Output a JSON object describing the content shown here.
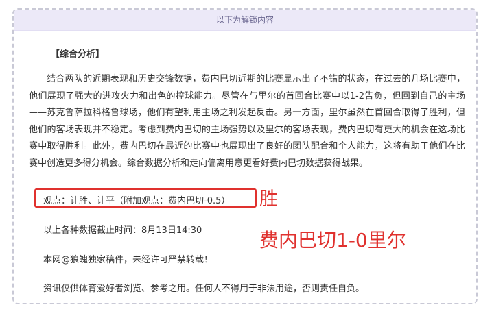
{
  "header": {
    "label": "以下为解锁内容"
  },
  "article": {
    "section_title": "【综合分析】",
    "analysis_paragraph": "结合两队的近期表现和历史交锋数据，费内巴切近期的比赛显示出了不错的状态，在过去的几场比赛中，他们展现了强大的进攻火力和出色的控球能力。尽管在与里尔的首回合比赛中以1-2告负，但回到自己的主场——苏克鲁萨拉科格鲁球场，他们有望利用主场之利发起反击。另一方面，里尔虽然在首回合取得了胜利，但他们的客场表现并不稳定。考虑到费内巴切的主场强势以及里尔的客场表现，费内巴切有更大的机会在这场比赛中取得胜利。此外，费内巴切在最近的比赛中也展现出了良好的团队配合和个人能力，这将有助于他们在比赛中创造更多得分机会。综合数据分析和走向偏离用意更看好费内巴切数据获得战果。",
    "viewpoint": "观点：让胜、让平（附加观点：费内巴切-0.5）",
    "deadline": "以上各种数据截止时间：8月13日14:30",
    "copyright": "本网@狼魄独家稿件，未经许可严禁转载！",
    "disclaimer": "资讯仅供体育爱好者浏览、参考之用。任何人不得用于非法用途，否则责任自负。"
  },
  "annotations": {
    "result": "胜",
    "score_prediction": "费内巴切1-0里尔"
  },
  "colors": {
    "header_bg": "#ece9f8",
    "annotation_red": "#e0312e",
    "border_dashed": "#c9c9d6"
  }
}
